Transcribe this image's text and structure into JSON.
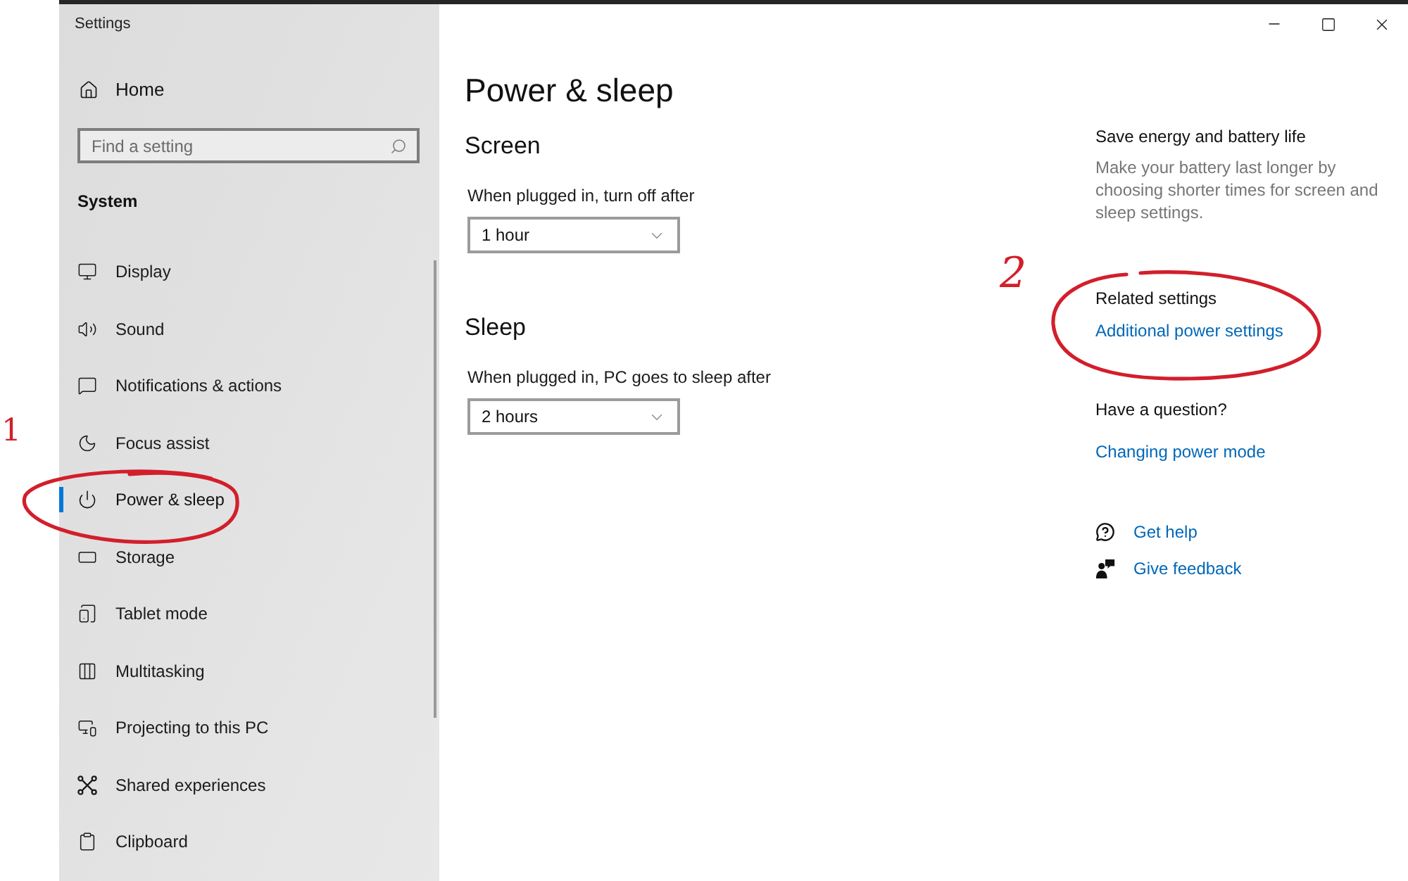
{
  "window": {
    "title": "Settings"
  },
  "sidebar": {
    "home": "Home",
    "search": {
      "placeholder": "Find a setting"
    },
    "section": "System",
    "items": [
      {
        "label": "Display",
        "selected": false
      },
      {
        "label": "Sound",
        "selected": false
      },
      {
        "label": "Notifications & actions",
        "selected": false
      },
      {
        "label": "Focus assist",
        "selected": false
      },
      {
        "label": "Power & sleep",
        "selected": true
      },
      {
        "label": "Storage",
        "selected": false
      },
      {
        "label": "Tablet mode",
        "selected": false
      },
      {
        "label": "Multitasking",
        "selected": false
      },
      {
        "label": "Projecting to this PC",
        "selected": false
      },
      {
        "label": "Shared experiences",
        "selected": false
      },
      {
        "label": "Clipboard",
        "selected": false
      }
    ]
  },
  "content": {
    "title": "Power & sleep",
    "sections": [
      {
        "heading": "Screen",
        "label": "When plugged in, turn off after",
        "value": "1 hour"
      },
      {
        "heading": "Sleep",
        "label": "When plugged in, PC goes to sleep after",
        "value": "2 hours"
      }
    ]
  },
  "aside": {
    "info": {
      "heading": "Save energy and battery life",
      "text": "Make your battery last longer by choosing shorter times for screen and sleep settings."
    },
    "related": {
      "heading": "Related settings",
      "links": [
        "Additional power settings"
      ]
    },
    "question": {
      "heading": "Have a question?",
      "links": [
        "Changing power mode"
      ]
    },
    "help_links": [
      "Get help",
      "Give feedback"
    ]
  },
  "annotations": [
    {
      "label": "1"
    },
    {
      "label": "2"
    }
  ]
}
